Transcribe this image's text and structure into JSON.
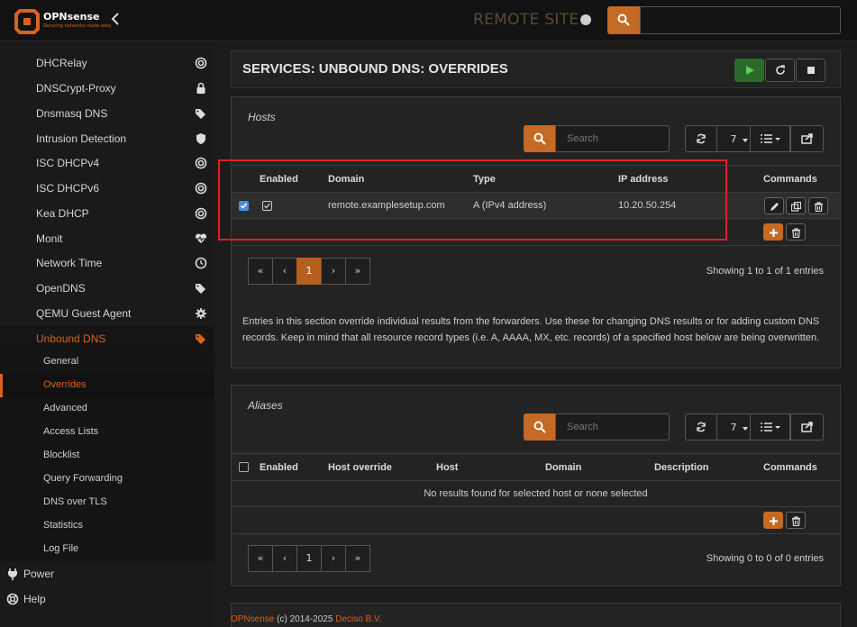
{
  "app": {
    "brand": "OPNsense",
    "tagline": "Securing networks made easy",
    "site_name": "REMOTE SITE"
  },
  "colors": {
    "accent": "#d9621e",
    "play": "#2a6a2a",
    "highlight": "#e02020"
  },
  "sidebar": {
    "items": [
      {
        "label": "DHCRelay",
        "icon": "target-icon"
      },
      {
        "label": "DNSCrypt-Proxy",
        "icon": "lock-icon"
      },
      {
        "label": "Dnsmasq DNS",
        "icon": "tags-icon"
      },
      {
        "label": "Intrusion Detection",
        "icon": "shield-icon"
      },
      {
        "label": "ISC DHCPv4",
        "icon": "target-icon"
      },
      {
        "label": "ISC DHCPv6",
        "icon": "target-icon"
      },
      {
        "label": "Kea DHCP",
        "icon": "target-icon"
      },
      {
        "label": "Monit",
        "icon": "heartbeat-icon"
      },
      {
        "label": "Network Time",
        "icon": "clock-icon"
      },
      {
        "label": "OpenDNS",
        "icon": "tags-icon"
      },
      {
        "label": "QEMU Guest Agent",
        "icon": "gear-icon"
      },
      {
        "label": "Unbound DNS",
        "icon": "tags-icon"
      }
    ],
    "subitems": [
      "General",
      "Overrides",
      "Advanced",
      "Access Lists",
      "Blocklist",
      "Query Forwarding",
      "DNS over TLS",
      "Statistics",
      "Log File"
    ],
    "root": [
      {
        "label": "Power",
        "icon": "plug-icon"
      },
      {
        "label": "Help",
        "icon": "lifebuoy-icon"
      }
    ]
  },
  "page": {
    "title": "SERVICES: UNBOUND DNS: OVERRIDES"
  },
  "hosts": {
    "title": "Hosts",
    "search_placeholder": "Search",
    "page_size": "7",
    "columns": [
      "Enabled",
      "Domain",
      "Type",
      "IP address",
      "Commands"
    ],
    "rows": [
      {
        "domain": "remote.examplesetup.com",
        "type": "A (IPv4 address)",
        "ip": "10.20.50.254"
      }
    ],
    "pager": [
      "«",
      "‹",
      "1",
      "›",
      "»"
    ],
    "showing": "Showing 1 to 1 of 1 entries",
    "note": "Entries in this section override individual results from the forwarders. Use these for changing DNS results or for adding custom DNS records. Keep in mind that all resource record types (i.e. A, AAAA, MX, etc. records) of a specified host below are being overwritten."
  },
  "aliases": {
    "title": "Aliases",
    "search_placeholder": "Search",
    "page_size": "7",
    "columns": [
      "Enabled",
      "Host override",
      "Host",
      "Domain",
      "Description",
      "Commands"
    ],
    "empty": "No results found for selected host or none selected",
    "pager": [
      "«",
      "‹",
      "1",
      "›",
      "»"
    ],
    "showing": "Showing 0 to 0 of 0 entries"
  },
  "footer": {
    "brand": "OPNsense",
    "copy": " (c) 2014-2025 ",
    "company": "Deciso B.V."
  }
}
